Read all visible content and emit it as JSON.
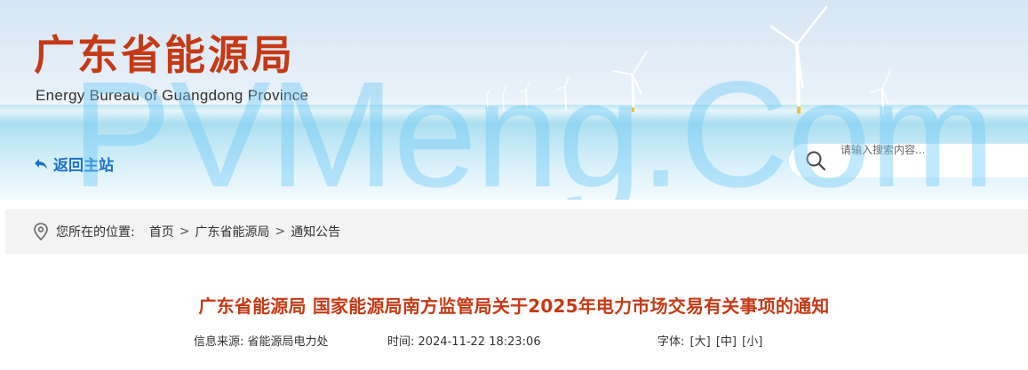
{
  "header": {
    "title": "广东省能源局",
    "subtitle": "Energy Bureau of Guangdong Province",
    "back_home": "返回主站",
    "search_placeholder": "请输入搜索内容..."
  },
  "watermark": "PVMeng.Com",
  "breadcrumb": {
    "prefix": "您所在的位置:",
    "items": [
      "首页",
      "广东省能源局",
      "通知公告"
    ],
    "separator": ">"
  },
  "article": {
    "title": "广东省能源局 国家能源局南方监管局关于2025年电力市场交易有关事项的通知",
    "source_label": "信息来源:",
    "source_value": "省能源局电力处",
    "time_label": "时间:",
    "time_value": "2024-11-22 18:23:06",
    "font_label": "字体:",
    "font_sizes": [
      "[大]",
      "[中]",
      "[小]"
    ]
  },
  "colors": {
    "title_red": "#c43a16",
    "link_blue": "#1e70c8",
    "breadcrumb_bg": "#f3f3f3"
  }
}
